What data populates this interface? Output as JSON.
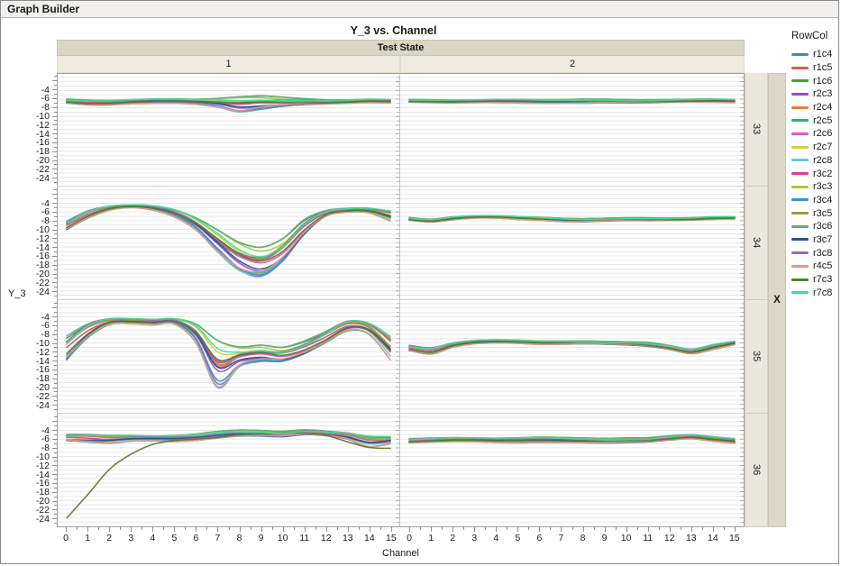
{
  "window": {
    "title": "Graph Builder"
  },
  "chart": {
    "title": "Y_3 vs. Channel",
    "x_axis_label": "Channel",
    "y_axis_label": "Y_3",
    "col_facet_title": "Test State",
    "col_facets": [
      "1",
      "2"
    ],
    "row_facets": [
      "33",
      "34",
      "35",
      "36"
    ],
    "row_facet_axis_label": "X"
  },
  "axes": {
    "y_tick_labels": [
      "-4",
      "-6",
      "-8",
      "-10",
      "-12",
      "-14",
      "-16",
      "-18",
      "-20",
      "-22",
      "-24"
    ],
    "x_tick_labels": [
      "0",
      "1",
      "2",
      "3",
      "4",
      "5",
      "6",
      "7",
      "8",
      "9",
      "10",
      "11",
      "12",
      "13",
      "14",
      "15"
    ]
  },
  "legend": {
    "title": "RowCol",
    "series": [
      {
        "name": "r1c4",
        "color": "#5b7cc9"
      },
      {
        "name": "r1c5",
        "color": "#da5c56"
      },
      {
        "name": "r1c6",
        "color": "#3ba23b"
      },
      {
        "name": "r2c3",
        "color": "#9d43cf"
      },
      {
        "name": "r2c4",
        "color": "#de8332"
      },
      {
        "name": "r2c5",
        "color": "#33ae7f"
      },
      {
        "name": "r2c6",
        "color": "#dd55cc"
      },
      {
        "name": "r2c7",
        "color": "#d5cc3c"
      },
      {
        "name": "r2c8",
        "color": "#66c7d9"
      },
      {
        "name": "r3c2",
        "color": "#e2399b"
      },
      {
        "name": "r3c3",
        "color": "#a8cb3a"
      },
      {
        "name": "r3c4",
        "color": "#3e8fd0"
      },
      {
        "name": "r3c5",
        "color": "#9a9a3a"
      },
      {
        "name": "r3c6",
        "color": "#67ab7d"
      },
      {
        "name": "r3c7",
        "color": "#2a4e8f"
      },
      {
        "name": "r3c8",
        "color": "#8f6fc5"
      },
      {
        "name": "r4c5",
        "color": "#f09578"
      },
      {
        "name": "r7c3",
        "color": "#597b2b"
      },
      {
        "name": "r7c8",
        "color": "#3edd96"
      }
    ]
  },
  "chart_data": {
    "type": "line",
    "title": "Y_3 vs. Channel",
    "xlabel": "Channel",
    "ylabel": "Y_3",
    "col_facet": "Test State",
    "row_facet": "X",
    "x": [
      0,
      1,
      2,
      3,
      4,
      5,
      6,
      7,
      8,
      9,
      10,
      11,
      12,
      13,
      14,
      15
    ],
    "x_domain": [
      -0.42,
      15.42
    ],
    "y_domain": [
      -0.2,
      -25.9
    ],
    "y_major_ticks": [
      -4,
      -6,
      -8,
      -10,
      -12,
      -14,
      -16,
      -18,
      -20,
      -22,
      -24
    ],
    "grid": "horizontal-minor-every-1",
    "legend_position": "right",
    "series_names": [
      "r1c4",
      "r1c5",
      "r1c6",
      "r2c3",
      "r2c4",
      "r2c5",
      "r2c6",
      "r2c7",
      "r2c8",
      "r3c2",
      "r3c3",
      "r3c4",
      "r3c5",
      "r3c6",
      "r3c7",
      "r3c8",
      "r4c5",
      "r7c3",
      "r7c8"
    ],
    "panels": [
      {
        "row": "33",
        "col": "1",
        "upper": [
          -5.9,
          -6.0,
          -6.1,
          -6.0,
          -5.9,
          -5.9,
          -6.0,
          -5.8,
          -5.4,
          -5.2,
          -5.5,
          -5.8,
          -6.0,
          -6.0,
          -5.9,
          -6.0
        ],
        "lower": [
          -7.1,
          -7.5,
          -7.4,
          -7.1,
          -7.0,
          -7.0,
          -7.2,
          -7.9,
          -9.1,
          -8.5,
          -7.9,
          -7.5,
          -7.3,
          -7.0,
          -6.8,
          -6.9
        ]
      },
      {
        "row": "33",
        "col": "2",
        "upper": [
          -6.0,
          -6.0,
          -6.1,
          -6.1,
          -6.0,
          -6.0,
          -6.1,
          -6.1,
          -6.0,
          -6.0,
          -6.1,
          -6.1,
          -6.0,
          -5.9,
          -5.9,
          -6.0
        ],
        "lower": [
          -6.8,
          -6.9,
          -6.9,
          -6.8,
          -6.8,
          -6.9,
          -7.0,
          -7.0,
          -7.0,
          -6.9,
          -6.9,
          -6.9,
          -6.8,
          -6.7,
          -6.7,
          -6.8
        ]
      },
      {
        "row": "34",
        "col": "1",
        "upper": [
          -7.9,
          -5.4,
          -4.5,
          -4.3,
          -4.5,
          -5.4,
          -7.3,
          -10.0,
          -12.8,
          -13.9,
          -12.0,
          -7.6,
          -5.5,
          -5.0,
          -5.0,
          -5.6
        ],
        "lower": [
          -10.4,
          -7.6,
          -5.6,
          -5.0,
          -5.6,
          -7.2,
          -10.2,
          -15.2,
          -19.6,
          -21.0,
          -17.8,
          -11.8,
          -7.2,
          -6.1,
          -6.2,
          -8.1
        ]
      },
      {
        "row": "34",
        "col": "2",
        "upper": [
          -7.2,
          -7.5,
          -7.0,
          -6.8,
          -6.8,
          -7.0,
          -7.2,
          -7.4,
          -7.5,
          -7.4,
          -7.3,
          -7.3,
          -7.3,
          -7.2,
          -7.0,
          -7.0
        ],
        "lower": [
          -8.0,
          -8.4,
          -7.8,
          -7.4,
          -7.4,
          -7.7,
          -7.9,
          -8.2,
          -8.3,
          -8.1,
          -8.0,
          -8.0,
          -8.0,
          -7.9,
          -7.7,
          -7.6
        ]
      },
      {
        "row": "35",
        "col": "1",
        "upper": [
          -7.9,
          -5.0,
          -4.2,
          -4.3,
          -4.5,
          -4.4,
          -5.6,
          -9.2,
          -10.8,
          -10.4,
          -10.9,
          -9.4,
          -7.0,
          -4.6,
          -5.1,
          -8.1
        ],
        "lower": [
          -14.9,
          -9.1,
          -5.8,
          -5.6,
          -5.9,
          -5.7,
          -10.1,
          -20.4,
          -15.6,
          -14.4,
          -14.5,
          -13.0,
          -10.4,
          -7.4,
          -8.0,
          -13.9
        ]
      },
      {
        "row": "35",
        "col": "2",
        "upper": [
          -10.4,
          -10.8,
          -9.8,
          -9.3,
          -9.2,
          -9.3,
          -9.5,
          -9.5,
          -9.5,
          -9.6,
          -9.7,
          -9.8,
          -10.4,
          -11.2,
          -10.2,
          -9.5
        ],
        "lower": [
          -11.9,
          -12.7,
          -11.0,
          -10.2,
          -10.0,
          -10.1,
          -10.3,
          -10.3,
          -10.2,
          -10.3,
          -10.5,
          -10.9,
          -11.6,
          -12.5,
          -11.5,
          -10.4
        ]
      },
      {
        "row": "36",
        "col": "1",
        "upper": [
          -4.8,
          -4.6,
          -4.8,
          -5.0,
          -5.2,
          -5.1,
          -4.8,
          -4.2,
          -3.9,
          -4.0,
          -4.2,
          -3.8,
          -4.0,
          -4.3,
          -5.0,
          -5.3
        ],
        "lower": [
          -6.6,
          -6.9,
          -7.0,
          -6.5,
          -6.4,
          -6.6,
          -6.3,
          -5.8,
          -5.4,
          -5.4,
          -5.6,
          -5.2,
          -5.4,
          -6.1,
          -7.8,
          -7.1
        ]
      },
      {
        "row": "36",
        "col": "2",
        "upper": [
          -5.8,
          -5.6,
          -5.5,
          -5.6,
          -5.7,
          -5.6,
          -5.5,
          -5.6,
          -5.7,
          -5.8,
          -5.7,
          -5.6,
          -5.1,
          -4.8,
          -5.3,
          -5.8
        ],
        "lower": [
          -7.0,
          -6.8,
          -6.6,
          -6.6,
          -6.8,
          -6.9,
          -6.8,
          -6.8,
          -6.9,
          -7.0,
          -6.9,
          -6.8,
          -6.4,
          -6.0,
          -6.5,
          -7.0
        ]
      }
    ],
    "series_overrides": [
      {
        "panel": "36-1",
        "series": "r7c3",
        "values": [
          -24.0,
          -18.5,
          -12.8,
          -9.4,
          -7.2,
          -6.3,
          -6.0,
          -5.6,
          -5.0,
          -4.8,
          -4.6,
          -4.6,
          -5.1,
          -6.6,
          -7.9,
          -8.1
        ]
      }
    ]
  }
}
